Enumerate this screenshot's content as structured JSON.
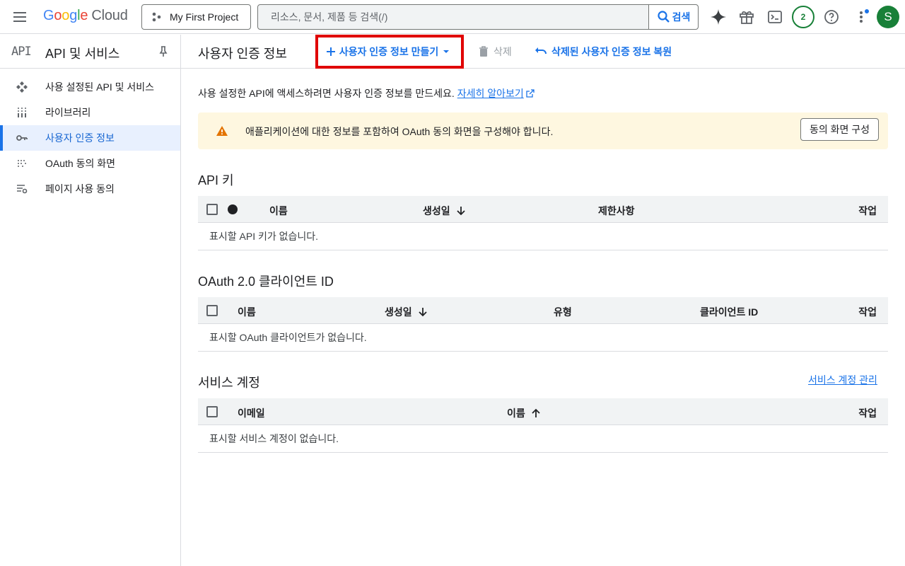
{
  "topbar": {
    "logo_letters": [
      "G",
      "o",
      "o",
      "g",
      "l",
      "e"
    ],
    "logo_cloud": "Cloud",
    "project_name": "My First Project",
    "search_placeholder": "리소스, 문서, 제품 등 검색(/)",
    "search_button": "검색",
    "notification_count": "2",
    "avatar_initial": "S",
    "icons": [
      "menu-icon",
      "gemini-icon",
      "gift-icon",
      "cloud-shell-icon",
      "help-icon",
      "more-vert-icon"
    ]
  },
  "sidebar": {
    "logo": "API",
    "title": "API 및 서비스",
    "items": [
      {
        "label": "사용 설정된 API 및 서비스",
        "icon": "api-icon"
      },
      {
        "label": "라이브러리",
        "icon": "library-icon"
      },
      {
        "label": "사용자 인증 정보",
        "icon": "key-icon",
        "active": true
      },
      {
        "label": "OAuth 동의 화면",
        "icon": "consent-icon"
      },
      {
        "label": "페이지 사용 동의",
        "icon": "settings-list-icon"
      }
    ]
  },
  "main": {
    "title": "사용자 인증 정보",
    "create_button": "사용자 인증 정보 만들기",
    "delete_button": "삭제",
    "restore_button": "삭제된 사용자 인증 정보 복원",
    "intro_text": "사용 설정한 API에 액세스하려면 사용자 인증 정보를 만드세요.",
    "learn_more": "자세히 알아보기",
    "warning_text": "애플리케이션에 대한 정보를 포함하여 OAuth 동의 화면을 구성해야 합니다.",
    "warning_button": "동의 화면 구성",
    "api_keys": {
      "title": "API 키",
      "columns": [
        "이름",
        "생성일",
        "제한사항",
        "작업"
      ],
      "empty": "표시할 API 키가 없습니다."
    },
    "oauth": {
      "title": "OAuth 2.0 클라이언트 ID",
      "columns": [
        "이름",
        "생성일",
        "유형",
        "클라이언트 ID",
        "작업"
      ],
      "empty": "표시할 OAuth 클라이언트가 없습니다."
    },
    "service_accounts": {
      "title": "서비스 계정",
      "manage_link": "서비스 계정 관리",
      "columns": [
        "이메일",
        "이름",
        "작업"
      ],
      "empty": "표시할 서비스 계정이 없습니다."
    }
  },
  "colors": {
    "accent": "#1a73e8",
    "highlight_border": "#e00000",
    "warning_bg": "#fef7e0",
    "warning_icon": "#e37400"
  }
}
